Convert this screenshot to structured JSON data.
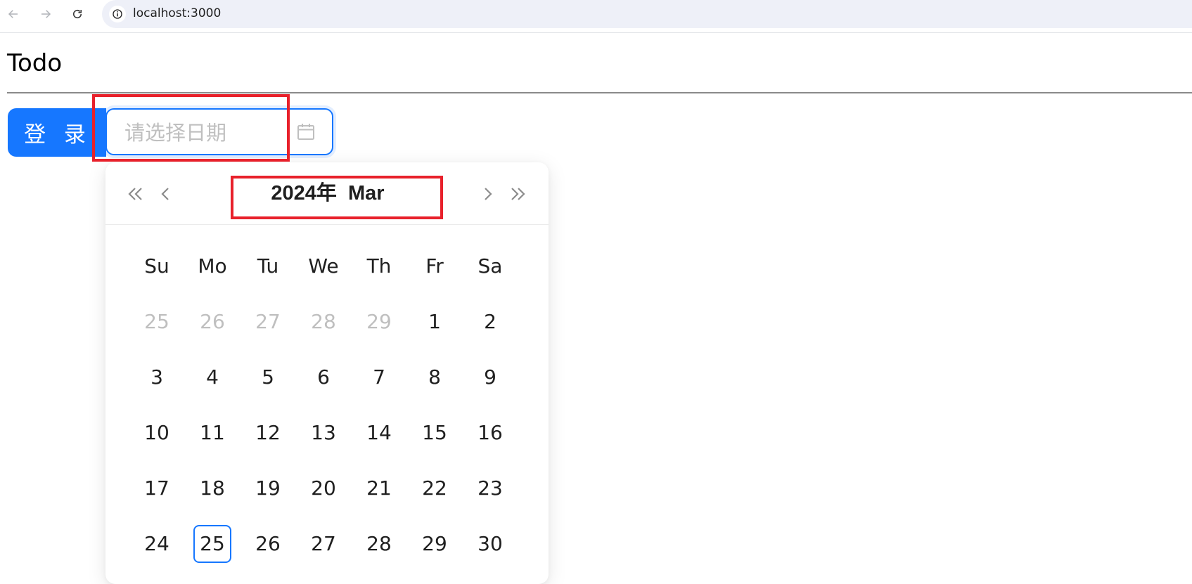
{
  "browser": {
    "url": "localhost:3000"
  },
  "page": {
    "title": "Todo"
  },
  "toolbar": {
    "login_label": "登 录"
  },
  "date_picker": {
    "placeholder": "请选择日期",
    "value": "",
    "header": {
      "title": "2024年  Mar"
    },
    "weekdays": [
      "Su",
      "Mo",
      "Tu",
      "We",
      "Th",
      "Fr",
      "Sa"
    ],
    "weeks": [
      [
        {
          "label": "25",
          "muted": true
        },
        {
          "label": "26",
          "muted": true
        },
        {
          "label": "27",
          "muted": true
        },
        {
          "label": "28",
          "muted": true
        },
        {
          "label": "29",
          "muted": true
        },
        {
          "label": "1",
          "muted": false
        },
        {
          "label": "2",
          "muted": false
        }
      ],
      [
        {
          "label": "3",
          "muted": false
        },
        {
          "label": "4",
          "muted": false
        },
        {
          "label": "5",
          "muted": false
        },
        {
          "label": "6",
          "muted": false
        },
        {
          "label": "7",
          "muted": false
        },
        {
          "label": "8",
          "muted": false
        },
        {
          "label": "9",
          "muted": false
        }
      ],
      [
        {
          "label": "10",
          "muted": false
        },
        {
          "label": "11",
          "muted": false
        },
        {
          "label": "12",
          "muted": false
        },
        {
          "label": "13",
          "muted": false
        },
        {
          "label": "14",
          "muted": false
        },
        {
          "label": "15",
          "muted": false
        },
        {
          "label": "16",
          "muted": false
        }
      ],
      [
        {
          "label": "17",
          "muted": false
        },
        {
          "label": "18",
          "muted": false
        },
        {
          "label": "19",
          "muted": false
        },
        {
          "label": "20",
          "muted": false
        },
        {
          "label": "21",
          "muted": false
        },
        {
          "label": "22",
          "muted": false
        },
        {
          "label": "23",
          "muted": false
        }
      ],
      [
        {
          "label": "24",
          "muted": false
        },
        {
          "label": "25",
          "muted": false,
          "today": true
        },
        {
          "label": "26",
          "muted": false
        },
        {
          "label": "27",
          "muted": false
        },
        {
          "label": "28",
          "muted": false
        },
        {
          "label": "29",
          "muted": false
        },
        {
          "label": "30",
          "muted": false
        }
      ]
    ]
  },
  "icons": {
    "back": "arrow-left-icon",
    "forward": "arrow-right-icon",
    "reload": "reload-icon",
    "site_info": "info-icon",
    "calendar": "calendar-icon",
    "super_prev": "double-chevron-left-icon",
    "prev": "chevron-left-icon",
    "next": "chevron-right-icon",
    "super_next": "double-chevron-right-icon"
  },
  "colors": {
    "primary": "#1677ff",
    "annotation": "#e8212b",
    "muted_text": "#bfbfbf"
  }
}
